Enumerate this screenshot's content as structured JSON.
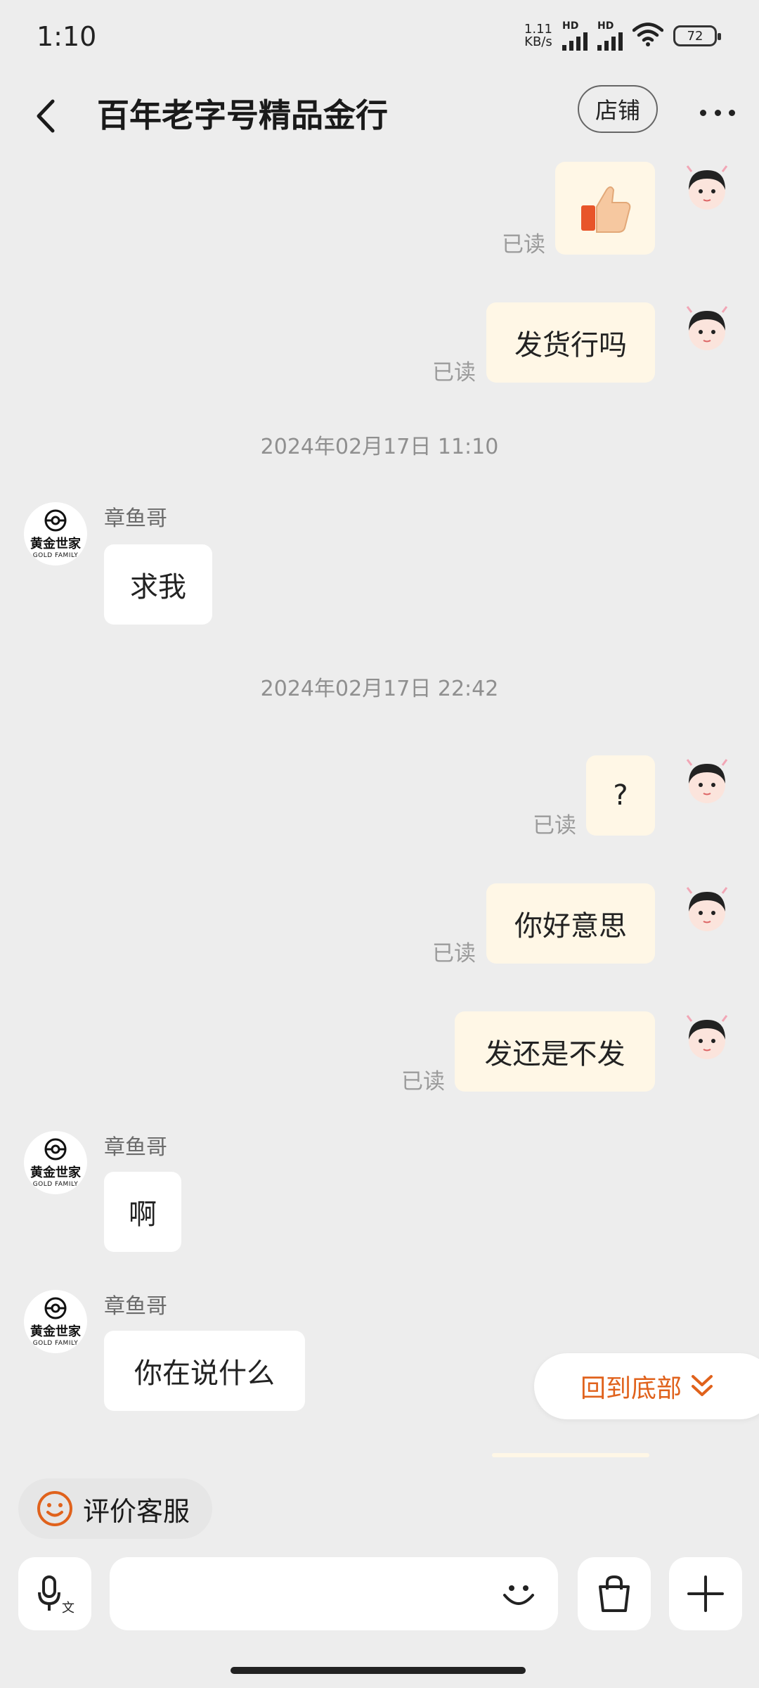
{
  "status_bar": {
    "time": "1:10",
    "net_speed_value": "1.11",
    "net_speed_unit": "KB/s",
    "sim1": "HD",
    "sim2": "HD",
    "battery": "72"
  },
  "header": {
    "title": "百年老字号精品金行",
    "shop_label": "店铺"
  },
  "messages": [
    {
      "from": "me",
      "type": "emoji",
      "emoji": "👍",
      "read": "已读"
    },
    {
      "from": "me",
      "text": "发货行吗",
      "read": "已读"
    },
    {
      "timestamp": "2024年02月17日 11:10"
    },
    {
      "from": "other",
      "sender": "章鱼哥",
      "text": "求我"
    },
    {
      "timestamp": "2024年02月17日 22:42"
    },
    {
      "from": "me",
      "text": "?",
      "read": "已读"
    },
    {
      "from": "me",
      "text": "你好意思",
      "read": "已读"
    },
    {
      "from": "me",
      "text": "发还是不发",
      "read": "已读"
    },
    {
      "from": "other",
      "sender": "章鱼哥",
      "text": "啊"
    },
    {
      "from": "other",
      "sender": "章鱼哥",
      "text": "你在说什么"
    }
  ],
  "shop_avatar": {
    "cn": "黄金世家",
    "en": "GOLD FAMILY"
  },
  "back_to_bottom": "回到底部",
  "rate_service": "评价客服",
  "input": {
    "placeholder": "",
    "value": ""
  },
  "icons": [
    "back-arrow-icon",
    "more-icon",
    "thumbs-up-icon",
    "voice-to-text-icon",
    "emoji-icon",
    "shopping-bag-icon",
    "plus-icon",
    "smile-icon",
    "chevron-double-down-icon"
  ],
  "colors": {
    "accent": "#e0621c",
    "my_bubble": "#fff7e6",
    "other_bubble": "#ffffff",
    "background": "#ededed"
  }
}
